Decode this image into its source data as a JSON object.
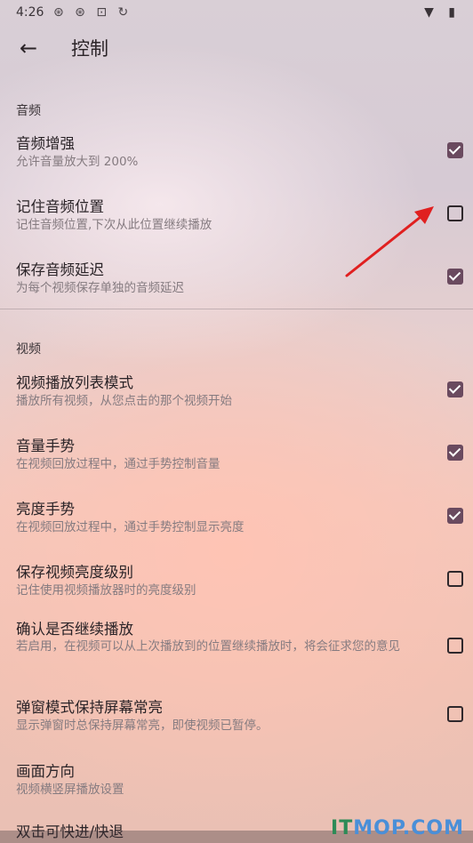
{
  "status_bar": {
    "time": "4:26",
    "left_icons": "⊛ ⊛ ⊡ ↻",
    "right_icons": "▼ ▮"
  },
  "toolbar": {
    "title": "控制"
  },
  "sections": [
    {
      "header": "音频"
    },
    {
      "header": "视频"
    }
  ],
  "items": [
    {
      "title": "音频增强",
      "subtitle": "允许音量放大到 200%",
      "checked": true
    },
    {
      "title": "记住音频位置",
      "subtitle": "记住音频位置,下次从此位置继续播放",
      "checked": false
    },
    {
      "title": "保存音频延迟",
      "subtitle": "为每个视频保存单独的音频延迟",
      "checked": true
    },
    {
      "title": "视频播放列表模式",
      "subtitle": "播放所有视频，从您点击的那个视频开始",
      "checked": true
    },
    {
      "title": "音量手势",
      "subtitle": "在视频回放过程中，通过手势控制音量",
      "checked": true
    },
    {
      "title": "亮度手势",
      "subtitle": "在视频回放过程中，通过手势控制显示亮度",
      "checked": true
    },
    {
      "title": "保存视频亮度级别",
      "subtitle": "记住使用视频播放器时的亮度级别",
      "checked": false
    },
    {
      "title": "确认是否继续播放",
      "subtitle": "若启用，在视频可以从上次播放到的位置继续播放时，将会征求您的意见",
      "checked": false
    },
    {
      "title": "弹窗模式保持屏幕常亮",
      "subtitle": "显示弹窗时总保持屏幕常亮，即使视频已暂停。",
      "checked": false
    },
    {
      "title": "画面方向",
      "subtitle": "视频横竖屏播放设置"
    }
  ],
  "partial_item": {
    "title": "双击可快进/快退"
  },
  "watermark": {
    "prefix": "IT",
    "rest": "MOP.COM"
  },
  "colors": {
    "checkbox_checked": "#6a4a5f",
    "annotation_arrow": "#e02020"
  }
}
